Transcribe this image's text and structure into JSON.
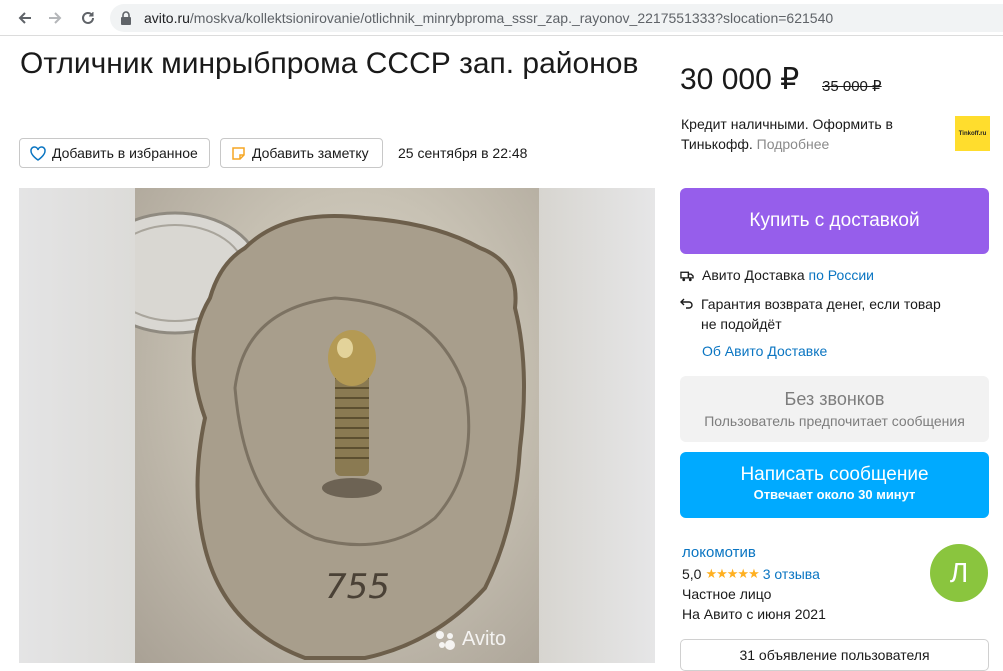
{
  "browser": {
    "url_host": "avito.ru",
    "url_path": "/moskva/kollektsionirovanie/otlichnik_minrybproma_sssr_zap._rayonov_2217551333?slocation=621540"
  },
  "listing": {
    "title": "Отличник минрыбпрома СССР зап. районов",
    "favorite_label": "Добавить в избранное",
    "note_label": "Добавить заметку",
    "date": "25 сентября в 22:48",
    "photo_engraving": "755",
    "watermark": "Avito"
  },
  "price": {
    "current": "30 000 ₽",
    "old": "35 000 ₽",
    "credit_text": "Кредит наличными. Оформить в Тинькофф.",
    "credit_more": "Подробнее",
    "bank_logo": "Tinkoff.ru"
  },
  "delivery": {
    "buy_label": "Купить с доставкой",
    "service_prefix": "Авито Доставка",
    "service_link": "по России",
    "guarantee": "Гарантия возврата денег, если товар не подойдёт",
    "about_link": "Об Авито Доставке"
  },
  "contact": {
    "no_calls_title": "Без звонков",
    "no_calls_sub": "Пользователь предпочитает сообщения",
    "message_label": "Написать сообщение",
    "message_sub": "Отвечает около 30 минут"
  },
  "seller": {
    "name": "локомотив",
    "rating": "5,0",
    "stars": "★★★★★",
    "reviews": "3 отзыва",
    "type": "Частное лицо",
    "since": "На Авито с июня 2021",
    "avatar_letter": "Л",
    "ads_label": "31 объявление пользователя"
  },
  "colors": {
    "buy": "#965eeb",
    "message": "#00aaff",
    "link": "#0a75c2",
    "avatar": "#8ac53e",
    "stars": "#ffb021"
  },
  "icons": [
    "back-arrow-icon",
    "forward-arrow-icon",
    "reload-icon",
    "lock-icon",
    "heart-icon",
    "note-icon",
    "truck-icon",
    "return-icon",
    "camera-icon"
  ]
}
